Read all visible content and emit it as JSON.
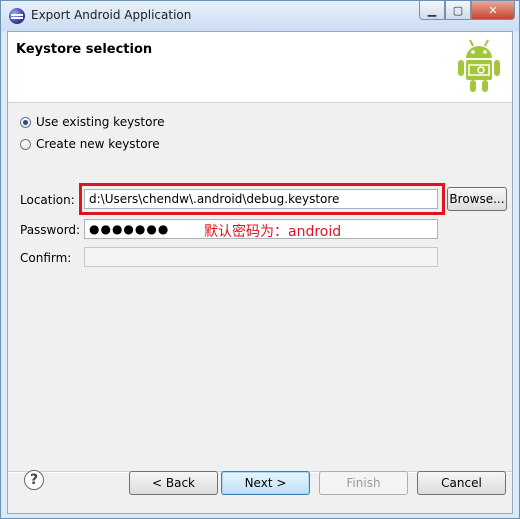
{
  "window": {
    "title": "Export Android Application",
    "min_glyph": "▁",
    "max_glyph": "▢",
    "close_glyph": "✕"
  },
  "banner": {
    "title": "Keystore selection",
    "icon": "android-robot-icon"
  },
  "options": {
    "use_existing": "Use existing keystore",
    "create_new": "Create new keystore"
  },
  "form": {
    "location_label": "Location:",
    "location_value": "d:\\Users\\chendw\\.android\\debug.keystore",
    "browse_label": "Browse...",
    "password_label": "Password:",
    "password_value": "●●●●●●●",
    "confirm_label": "Confirm:",
    "confirm_value": ""
  },
  "annotation": "默认密码为：android",
  "footer": {
    "help_glyph": "?",
    "back": "< Back",
    "next": "Next >",
    "finish": "Finish",
    "cancel": "Cancel"
  },
  "colors": {
    "highlight": "#e0141e",
    "android_green": "#a4c639"
  }
}
